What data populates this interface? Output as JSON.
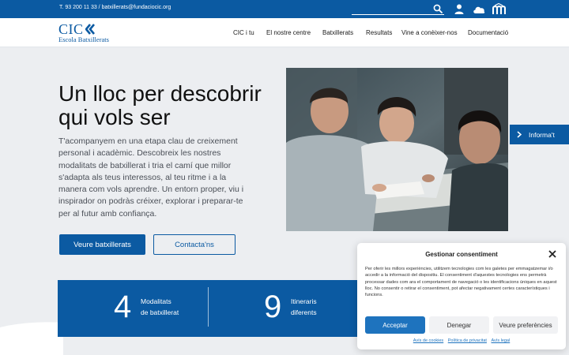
{
  "topbar": {
    "contact": "T. 93 200 11 33 / batxillerats@fundaciocic.org"
  },
  "logo": {
    "mark": "CIC",
    "subtitle": "Escola Batxillerats"
  },
  "nav": {
    "items": [
      "CIC i tu",
      "El nostre centre",
      "Batxillerats",
      "Resultats",
      "Vine a conèixer-nos",
      "Documentació"
    ]
  },
  "hero": {
    "title": "Un lloc per descobrir qui vols ser",
    "text": "T'acompanyem en una etapa clau de creixement personal i acadèmic. Descobreix les nostres modalitats de batxillerat i tria el camí que millor s'adapta als teus interessos, al teu ritme i a la manera com vols aprendre. Un entorn proper, viu i inspirador on podràs créixer, explorar i preparar-te per al futur amb confiança.",
    "primary_button": "Veure batxillerats",
    "secondary_button": "Contacta'ns"
  },
  "side_tab": {
    "label": "Informa't"
  },
  "stats": [
    {
      "number": "4",
      "label_line1": "Modalitats",
      "label_line2": "de batxillerat"
    },
    {
      "number": "9",
      "label_line1": "Itineraris",
      "label_line2": "diferents"
    }
  ],
  "consent": {
    "title": "Gestionar consentiment",
    "body": "Per oferir les millors experiències, utilitzem tecnologies com les galetes per emmagatzemar i/o accedir a la informació del dispositiu. El consentiment d'aquestes tecnologies ens permetrà processar dades com ara el comportament de navegació o les identificacions úniques en aquest lloc. No consentir o retirar el consentiment, pot afectar negativament certes característiques i funcions.",
    "accept": "Acceptar",
    "deny": "Denegar",
    "preferences": "Veure preferències",
    "links": [
      "Avís de cookies",
      "Política de privacitat",
      "Avís legal"
    ]
  },
  "colors": {
    "brand_blue": "#0b5aa2",
    "accept_blue": "#1e73be",
    "page_bg": "#eceef1"
  }
}
